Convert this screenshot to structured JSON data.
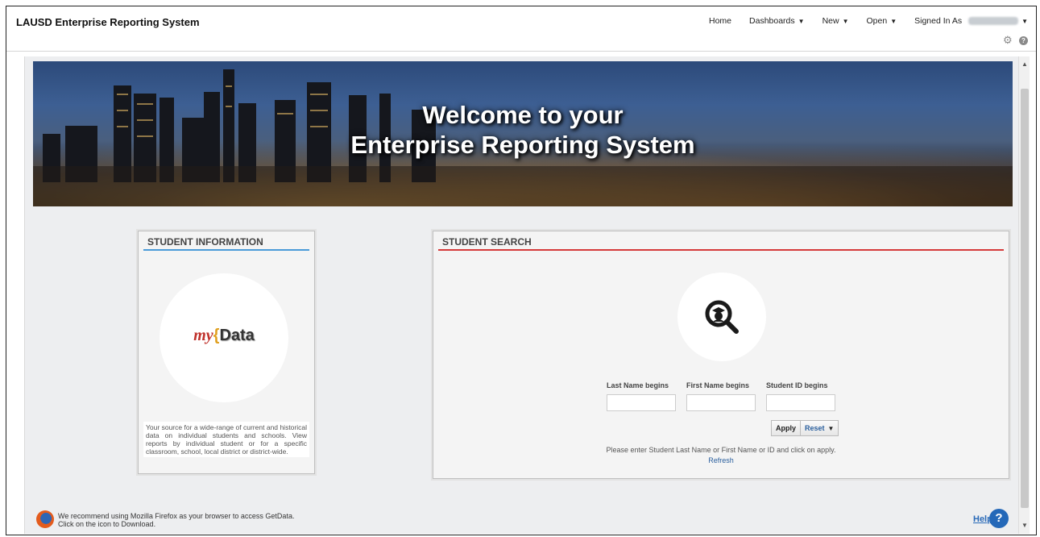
{
  "header": {
    "app_title": "LAUSD Enterprise Reporting System",
    "nav": {
      "home": "Home",
      "dashboards": "Dashboards",
      "new": "New",
      "open": "Open",
      "signed_in": "Signed In As"
    }
  },
  "banner": {
    "line1": "Welcome to your",
    "line2": "Enterprise Reporting System"
  },
  "student_info": {
    "heading": "STUDENT INFORMATION",
    "logo_my": "my",
    "logo_data": "Data",
    "description": "Your source for a wide-range of current and historical data on individual students and schools. View reports by individual student or for a specific classroom, school, local district or district-wide."
  },
  "student_search": {
    "heading": "STUDENT SEARCH",
    "last_name_label": "Last Name begins",
    "first_name_label": "First Name begins",
    "student_id_label": "Student ID begins",
    "last_name_value": "",
    "first_name_value": "",
    "student_id_value": "",
    "apply_label": "Apply",
    "reset_label": "Reset",
    "hint": "Please enter Student Last Name or First Name or ID and click on apply.",
    "refresh_label": "Refresh"
  },
  "footer": {
    "browser_line1": "We recommend using Mozilla Firefox as your browser to access GetData.",
    "browser_line2": "Click on the icon to Download.",
    "help_label": "Help"
  },
  "colors": {
    "info_underline": "#4a9bd8",
    "search_underline": "#d53a3a",
    "link": "#2a6ab8"
  }
}
